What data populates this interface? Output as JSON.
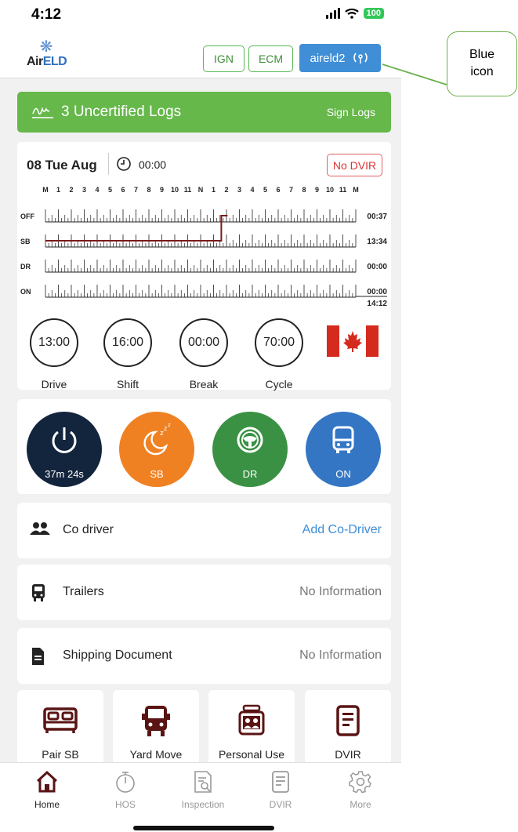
{
  "status_bar": {
    "time": "4:12",
    "battery": "100"
  },
  "header": {
    "logo_text_a": "Air",
    "logo_text_b": "ELD",
    "ign_label": "IGN",
    "ecm_label": "ECM",
    "device_label": "aireld2"
  },
  "banner": {
    "title": "3 Uncertified Logs",
    "action": "Sign Logs"
  },
  "log": {
    "date": "08 Tue Aug",
    "time": "00:00",
    "dvir_badge": "No DVIR",
    "hour_labels": [
      "M",
      "1",
      "2",
      "3",
      "4",
      "5",
      "6",
      "7",
      "8",
      "9",
      "10",
      "11",
      "N",
      "1",
      "2",
      "3",
      "4",
      "5",
      "6",
      "7",
      "8",
      "9",
      "10",
      "11",
      "M"
    ],
    "rows": [
      {
        "status": "OFF",
        "total": "00:37"
      },
      {
        "status": "SB",
        "total": "13:34"
      },
      {
        "status": "DR",
        "total": "00:00"
      },
      {
        "status": "ON",
        "total": "00:00"
      }
    ],
    "grand_total": "14:12",
    "sb_until_hour": 13.6,
    "line_color": "#7a1a1a"
  },
  "timers": [
    {
      "value": "13:00",
      "label": "Drive"
    },
    {
      "value": "16:00",
      "label": "Shift"
    },
    {
      "value": "00:00",
      "label": "Break"
    },
    {
      "value": "70:00",
      "label": "Cycle"
    }
  ],
  "status_buttons": [
    {
      "label": "37m 24s",
      "icon": "power-icon",
      "color": "#13243d"
    },
    {
      "label": "SB",
      "icon": "sleep-moon-icon",
      "color": "#f08122"
    },
    {
      "label": "DR",
      "icon": "steering-wheel-icon",
      "color": "#3a9144"
    },
    {
      "label": "ON",
      "icon": "bus-icon",
      "color": "#3476c4"
    }
  ],
  "info_rows": {
    "co_driver": {
      "label": "Co driver",
      "value": "Add Co-Driver"
    },
    "trailers": {
      "label": "Trailers",
      "value": "No Information"
    },
    "shipping": {
      "label": "Shipping Document",
      "value": "No Information"
    }
  },
  "quick_actions": [
    {
      "label": "Pair SB",
      "icon": "bed-icon"
    },
    {
      "label": "Yard Move",
      "icon": "truck-front-icon"
    },
    {
      "label": "Personal Use",
      "icon": "personal-use-icon"
    },
    {
      "label": "DVIR",
      "icon": "document-icon"
    }
  ],
  "tabs": [
    {
      "label": "Home",
      "icon": "home-icon"
    },
    {
      "label": "HOS",
      "icon": "stopwatch-icon"
    },
    {
      "label": "Inspection",
      "icon": "inspection-icon"
    },
    {
      "label": "DVIR",
      "icon": "dvir-icon"
    },
    {
      "label": "More",
      "icon": "gear-icon"
    }
  ],
  "colors": {
    "accent_green": "#66b84a",
    "accent_blue": "#3f8ed6",
    "brand_dark_red": "#5a1414"
  },
  "callout": {
    "line1": "Blue",
    "line2": "icon"
  }
}
